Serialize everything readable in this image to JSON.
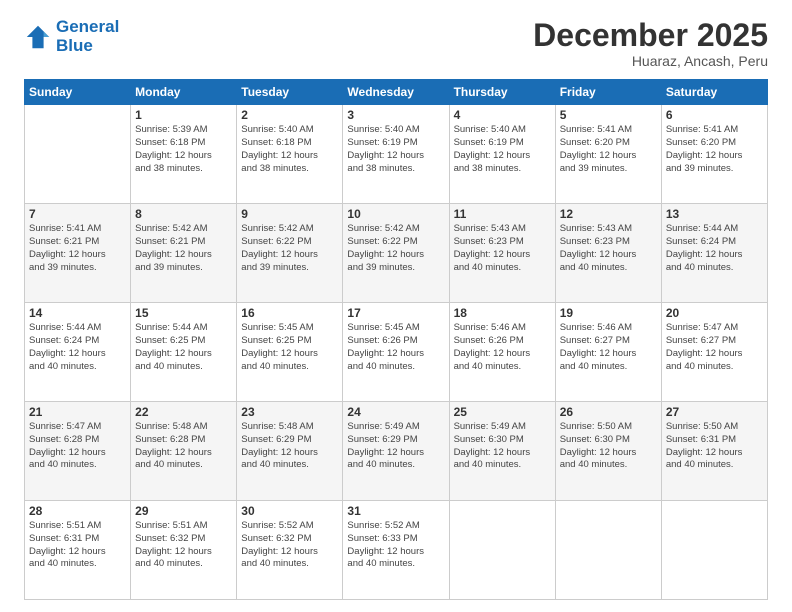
{
  "logo": {
    "line1": "General",
    "line2": "Blue"
  },
  "title": "December 2025",
  "subtitle": "Huaraz, Ancash, Peru",
  "days_of_week": [
    "Sunday",
    "Monday",
    "Tuesday",
    "Wednesday",
    "Thursday",
    "Friday",
    "Saturday"
  ],
  "weeks": [
    [
      {
        "day": "",
        "info": ""
      },
      {
        "day": "1",
        "info": "Sunrise: 5:39 AM\nSunset: 6:18 PM\nDaylight: 12 hours\nand 38 minutes."
      },
      {
        "day": "2",
        "info": "Sunrise: 5:40 AM\nSunset: 6:18 PM\nDaylight: 12 hours\nand 38 minutes."
      },
      {
        "day": "3",
        "info": "Sunrise: 5:40 AM\nSunset: 6:19 PM\nDaylight: 12 hours\nand 38 minutes."
      },
      {
        "day": "4",
        "info": "Sunrise: 5:40 AM\nSunset: 6:19 PM\nDaylight: 12 hours\nand 38 minutes."
      },
      {
        "day": "5",
        "info": "Sunrise: 5:41 AM\nSunset: 6:20 PM\nDaylight: 12 hours\nand 39 minutes."
      },
      {
        "day": "6",
        "info": "Sunrise: 5:41 AM\nSunset: 6:20 PM\nDaylight: 12 hours\nand 39 minutes."
      }
    ],
    [
      {
        "day": "7",
        "info": "Sunrise: 5:41 AM\nSunset: 6:21 PM\nDaylight: 12 hours\nand 39 minutes."
      },
      {
        "day": "8",
        "info": "Sunrise: 5:42 AM\nSunset: 6:21 PM\nDaylight: 12 hours\nand 39 minutes."
      },
      {
        "day": "9",
        "info": "Sunrise: 5:42 AM\nSunset: 6:22 PM\nDaylight: 12 hours\nand 39 minutes."
      },
      {
        "day": "10",
        "info": "Sunrise: 5:42 AM\nSunset: 6:22 PM\nDaylight: 12 hours\nand 39 minutes."
      },
      {
        "day": "11",
        "info": "Sunrise: 5:43 AM\nSunset: 6:23 PM\nDaylight: 12 hours\nand 40 minutes."
      },
      {
        "day": "12",
        "info": "Sunrise: 5:43 AM\nSunset: 6:23 PM\nDaylight: 12 hours\nand 40 minutes."
      },
      {
        "day": "13",
        "info": "Sunrise: 5:44 AM\nSunset: 6:24 PM\nDaylight: 12 hours\nand 40 minutes."
      }
    ],
    [
      {
        "day": "14",
        "info": "Sunrise: 5:44 AM\nSunset: 6:24 PM\nDaylight: 12 hours\nand 40 minutes."
      },
      {
        "day": "15",
        "info": "Sunrise: 5:44 AM\nSunset: 6:25 PM\nDaylight: 12 hours\nand 40 minutes."
      },
      {
        "day": "16",
        "info": "Sunrise: 5:45 AM\nSunset: 6:25 PM\nDaylight: 12 hours\nand 40 minutes."
      },
      {
        "day": "17",
        "info": "Sunrise: 5:45 AM\nSunset: 6:26 PM\nDaylight: 12 hours\nand 40 minutes."
      },
      {
        "day": "18",
        "info": "Sunrise: 5:46 AM\nSunset: 6:26 PM\nDaylight: 12 hours\nand 40 minutes."
      },
      {
        "day": "19",
        "info": "Sunrise: 5:46 AM\nSunset: 6:27 PM\nDaylight: 12 hours\nand 40 minutes."
      },
      {
        "day": "20",
        "info": "Sunrise: 5:47 AM\nSunset: 6:27 PM\nDaylight: 12 hours\nand 40 minutes."
      }
    ],
    [
      {
        "day": "21",
        "info": "Sunrise: 5:47 AM\nSunset: 6:28 PM\nDaylight: 12 hours\nand 40 minutes."
      },
      {
        "day": "22",
        "info": "Sunrise: 5:48 AM\nSunset: 6:28 PM\nDaylight: 12 hours\nand 40 minutes."
      },
      {
        "day": "23",
        "info": "Sunrise: 5:48 AM\nSunset: 6:29 PM\nDaylight: 12 hours\nand 40 minutes."
      },
      {
        "day": "24",
        "info": "Sunrise: 5:49 AM\nSunset: 6:29 PM\nDaylight: 12 hours\nand 40 minutes."
      },
      {
        "day": "25",
        "info": "Sunrise: 5:49 AM\nSunset: 6:30 PM\nDaylight: 12 hours\nand 40 minutes."
      },
      {
        "day": "26",
        "info": "Sunrise: 5:50 AM\nSunset: 6:30 PM\nDaylight: 12 hours\nand 40 minutes."
      },
      {
        "day": "27",
        "info": "Sunrise: 5:50 AM\nSunset: 6:31 PM\nDaylight: 12 hours\nand 40 minutes."
      }
    ],
    [
      {
        "day": "28",
        "info": "Sunrise: 5:51 AM\nSunset: 6:31 PM\nDaylight: 12 hours\nand 40 minutes."
      },
      {
        "day": "29",
        "info": "Sunrise: 5:51 AM\nSunset: 6:32 PM\nDaylight: 12 hours\nand 40 minutes."
      },
      {
        "day": "30",
        "info": "Sunrise: 5:52 AM\nSunset: 6:32 PM\nDaylight: 12 hours\nand 40 minutes."
      },
      {
        "day": "31",
        "info": "Sunrise: 5:52 AM\nSunset: 6:33 PM\nDaylight: 12 hours\nand 40 minutes."
      },
      {
        "day": "",
        "info": ""
      },
      {
        "day": "",
        "info": ""
      },
      {
        "day": "",
        "info": ""
      }
    ]
  ]
}
